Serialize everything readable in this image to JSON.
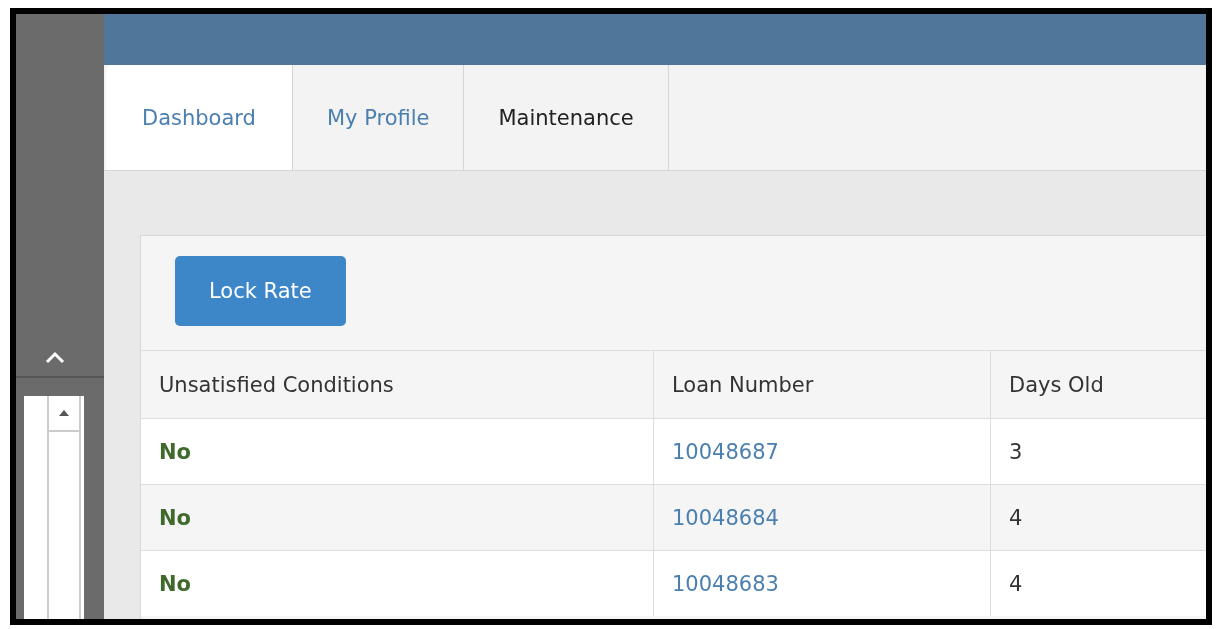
{
  "tabs": [
    {
      "label": "Dashboard",
      "selected": true
    },
    {
      "label": "My Profile",
      "selected": false
    },
    {
      "label": "Maintenance",
      "selected": false
    }
  ],
  "lock_button": "Lock Rate",
  "table": {
    "columns": [
      "Unsatisfied Conditions",
      "Loan Number",
      "Days Old"
    ],
    "rows": [
      {
        "unsatisfied_conditions": "No",
        "loan_number": "10048687",
        "days_old": "3"
      },
      {
        "unsatisfied_conditions": "No",
        "loan_number": "10048684",
        "days_old": "4"
      },
      {
        "unsatisfied_conditions": "No",
        "loan_number": "10048683",
        "days_old": "4"
      }
    ]
  }
}
